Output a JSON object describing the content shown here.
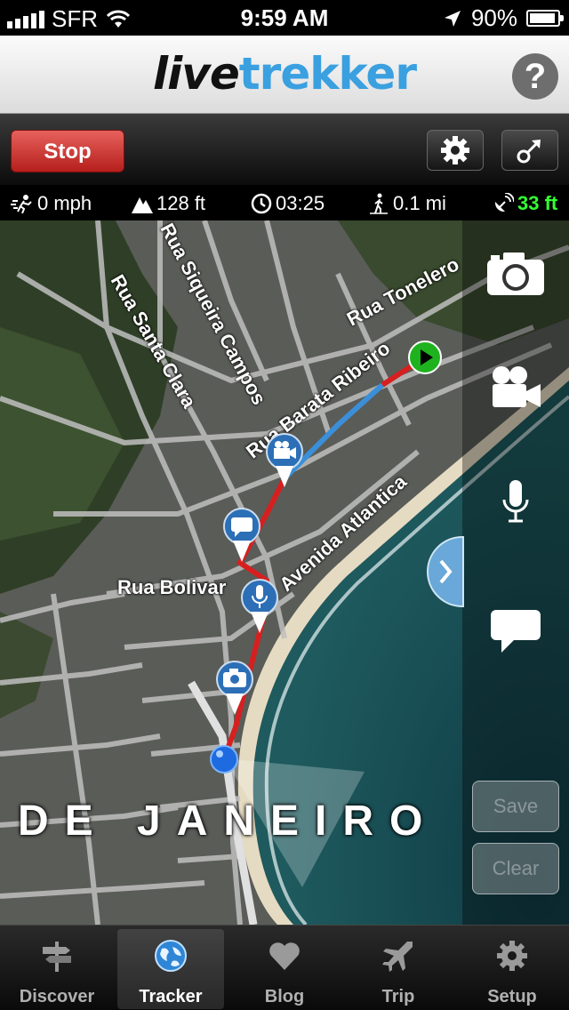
{
  "status_bar": {
    "carrier": "SFR",
    "time": "9:59 AM",
    "battery": "90%"
  },
  "header": {
    "logo_part1": "live",
    "logo_part2": "trekker",
    "help_label": "?"
  },
  "toolbar": {
    "stop_label": "Stop"
  },
  "stats": {
    "speed": "0 mph",
    "altitude": "128 ft",
    "duration": "03:25",
    "distance": "0.1 mi",
    "gps_accuracy": "33 ft"
  },
  "map": {
    "streets": [
      "Rua Siqueira Campos",
      "Rua Santa Clara",
      "Rua Tonelero",
      "Rua Barata Ribeiro",
      "Avenida Atlantica",
      "Rua Bolivar"
    ],
    "city_label": "DE JANEIRO"
  },
  "side_panel": {
    "save_label": "Save",
    "clear_label": "Clear"
  },
  "tabs": [
    {
      "label": "Discover",
      "icon": "signpost-icon"
    },
    {
      "label": "Tracker",
      "icon": "globe-icon"
    },
    {
      "label": "Blog",
      "icon": "heart-icon"
    },
    {
      "label": "Trip",
      "icon": "plane-icon"
    },
    {
      "label": "Setup",
      "icon": "gear-icon"
    }
  ],
  "active_tab": "Tracker",
  "colors": {
    "brand_blue": "#3aa0e0",
    "stop_red": "#c9302c",
    "gps_green": "#33ff33",
    "route_red": "#d62020",
    "route_blue": "#3b8fd9"
  }
}
